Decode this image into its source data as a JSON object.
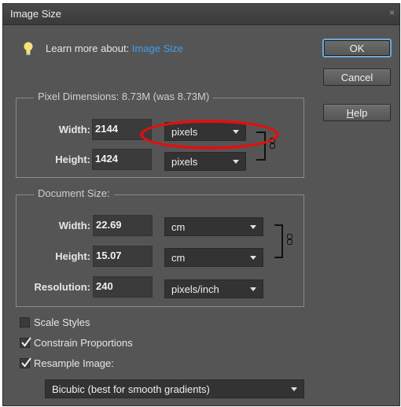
{
  "window": {
    "title": "Image Size",
    "close_glyph": "×"
  },
  "learn_more": {
    "prefix": "Learn more about:",
    "link": "Image Size",
    "icon": "lightbulb-icon",
    "icon_color": "#f6e27a",
    "link_color": "#3fa0f0"
  },
  "buttons": {
    "ok": "OK",
    "cancel": "Cancel",
    "help": "Help"
  },
  "pixel_dimensions": {
    "legend": "Pixel Dimensions:  8.73M (was 8.73M)",
    "width_label": "Width:",
    "width_value": "2144",
    "width_unit": "pixels",
    "height_label": "Height:",
    "height_value": "1424",
    "height_unit": "pixels"
  },
  "document_size": {
    "legend": "Document Size:",
    "width_label": "Width:",
    "width_value": "22.69",
    "width_unit": "cm",
    "height_label": "Height:",
    "height_value": "15.07",
    "height_unit": "cm",
    "resolution_label": "Resolution:",
    "resolution_value": "240",
    "resolution_unit": "pixels/inch"
  },
  "checkboxes": {
    "scale_styles": {
      "label": "Scale Styles",
      "checked": false
    },
    "constrain_proportions": {
      "label": "Constrain Proportions",
      "checked": true
    },
    "resample_image": {
      "label": "Resample Image:",
      "checked": true
    }
  },
  "resample_method": "Bicubic (best for smooth gradients)",
  "colors": {
    "background": "#555555",
    "annotation_circle": "#dd1111"
  }
}
